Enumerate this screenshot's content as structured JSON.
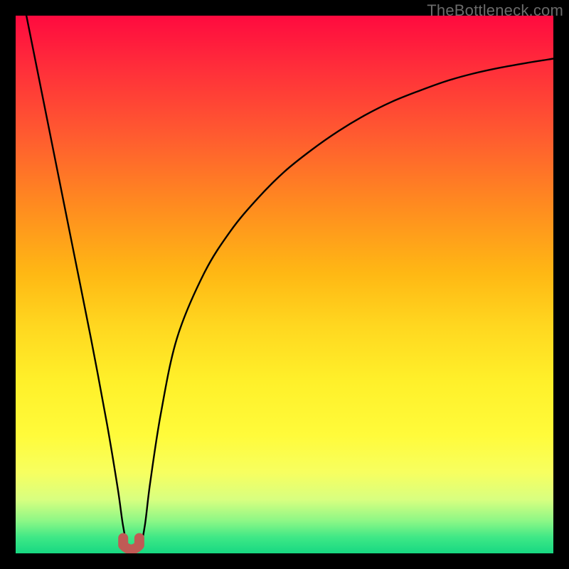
{
  "watermark": "TheBottleneck.com",
  "gradient": {
    "top": "#ff0a3f",
    "mid": "#ffe02a",
    "bottom": "#17d882"
  },
  "chart_data": {
    "type": "line",
    "title": "",
    "xlabel": "",
    "ylabel": "",
    "xlim": [
      0,
      100
    ],
    "ylim": [
      0,
      100
    ],
    "grid": false,
    "legend": false,
    "series": [
      {
        "name": "bottleneck-curve",
        "x": [
          2,
          5,
          8,
          11,
          14,
          17,
          19,
          20,
          21,
          23,
          24,
          25,
          27,
          30,
          35,
          40,
          45,
          50,
          55,
          60,
          65,
          70,
          75,
          80,
          85,
          90,
          95,
          100
        ],
        "y": [
          100,
          85,
          70,
          55,
          40,
          24,
          12,
          5,
          1,
          1,
          5,
          13,
          26,
          40,
          52,
          60,
          66,
          71,
          75,
          78.5,
          81.5,
          84,
          86,
          87.8,
          89.2,
          90.3,
          91.2,
          92
        ],
        "notch_x_range": [
          20,
          23
        ],
        "notch_y": 1
      }
    ],
    "annotations": []
  }
}
